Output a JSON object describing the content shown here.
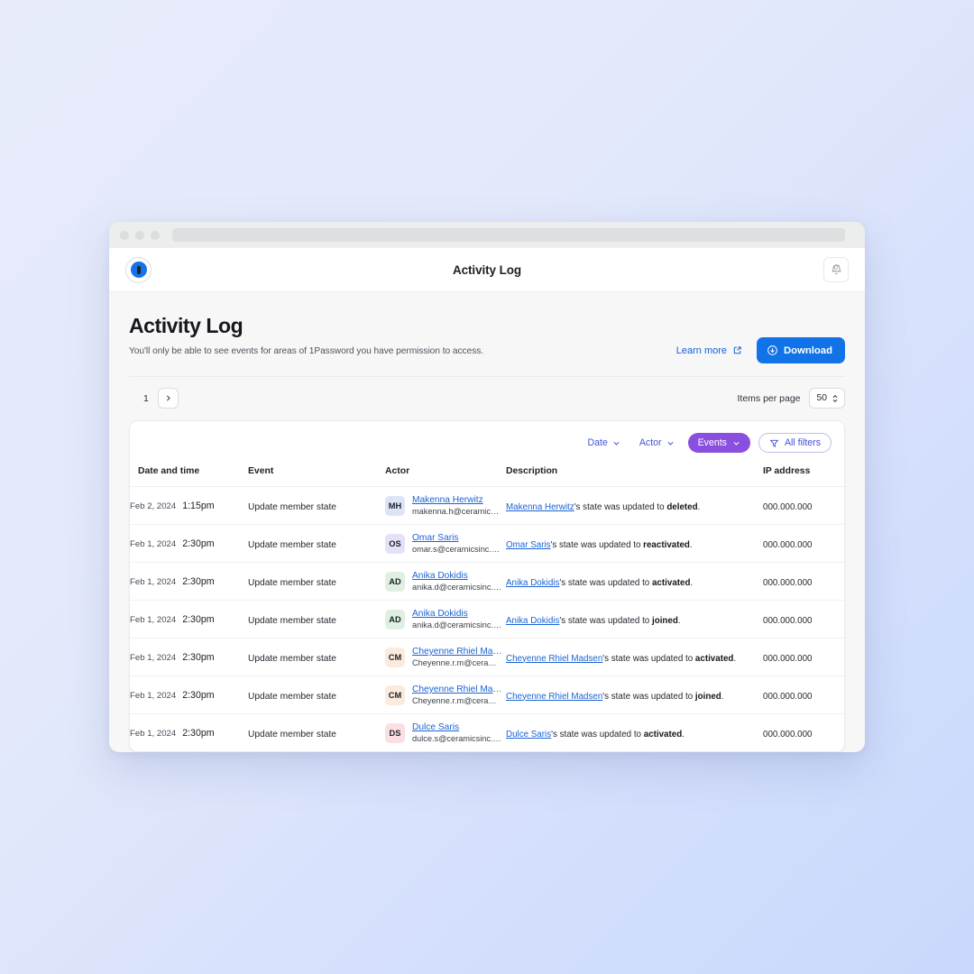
{
  "browser": {
    "traffic_lights": [
      "close",
      "minimize",
      "maximize"
    ],
    "address_bar_value": ""
  },
  "appbar": {
    "logo_icon": "1password-logo-icon",
    "title": "Activity Log",
    "notification_icon": "bell-icon",
    "notification_count": "0"
  },
  "page": {
    "title": "Activity Log",
    "subtitle": "You'll only be able to see events for areas of 1Password you have permission to access.",
    "learn_more_label": "Learn more",
    "learn_more_icon": "external-link-icon",
    "download_label": "Download",
    "download_icon": "download-circle-icon"
  },
  "pagination": {
    "current_page": "1",
    "next_icon": "chevron-right-icon",
    "items_per_page_label": "Items per page",
    "items_per_page_value": "50",
    "stepper_icon": "stepper-updown-icon"
  },
  "filters": {
    "date_label": "Date",
    "actor_label": "Actor",
    "events_label": "Events",
    "all_filters_label": "All filters",
    "chevron_icon": "chevron-down-icon",
    "funnel_icon": "funnel-icon",
    "events_active_color": "#8a4fe0",
    "link_color": "#4355d8"
  },
  "table": {
    "columns": [
      "Date and time",
      "Event",
      "Actor",
      "Description",
      "IP address"
    ],
    "rows": [
      {
        "date": "Feb 2, 2024",
        "time": "1:15pm",
        "event": "Update member state",
        "initials": "MH",
        "avatar_color": "#dbe5f5",
        "actor_name": "Makenna Herwitz",
        "actor_email": "makenna.h@ceramicsin...",
        "desc_link": "Makenna Herwitz",
        "desc_mid": "'s state was updated to ",
        "desc_bold": "deleted",
        "desc_end": ".",
        "ip": "000.000.000"
      },
      {
        "date": "Feb 1, 2024",
        "time": "2:30pm",
        "event": "Update member state",
        "initials": "OS",
        "avatar_color": "#e3e2f7",
        "actor_name": "Omar Saris",
        "actor_email": "omar.s@ceramicsinc.com",
        "desc_link": "Omar Saris",
        "desc_mid": "'s state was updated to ",
        "desc_bold": "reactivated",
        "desc_end": ".",
        "ip": "000.000.000"
      },
      {
        "date": "Feb 1, 2024",
        "time": "2:30pm",
        "event": "Update member state",
        "initials": "AD",
        "avatar_color": "#dff0e2",
        "actor_name": "Anika Dokidis",
        "actor_email": "anika.d@ceramicsinc.com",
        "desc_link": "Anika Dokidis",
        "desc_mid": "'s state was updated to ",
        "desc_bold": "activated",
        "desc_end": ".",
        "ip": "000.000.000"
      },
      {
        "date": "Feb 1, 2024",
        "time": "2:30pm",
        "event": "Update member state",
        "initials": "AD",
        "avatar_color": "#dff0e2",
        "actor_name": "Anika Dokidis",
        "actor_email": "anika.d@ceramicsinc.com",
        "desc_link": "Anika Dokidis",
        "desc_mid": "'s state was updated to ",
        "desc_bold": "joined",
        "desc_end": ".",
        "ip": "000.000.000"
      },
      {
        "date": "Feb 1, 2024",
        "time": "2:30pm",
        "event": "Update member state",
        "initials": "CM",
        "avatar_color": "#fbeade",
        "actor_name": "Cheyenne Rhiel Mad...",
        "actor_email": "Cheyenne.r.m@ceramic...",
        "desc_link": "Cheyenne Rhiel Madsen",
        "desc_mid": "'s state was updated to ",
        "desc_bold": "activated",
        "desc_end": ".",
        "ip": "000.000.000"
      },
      {
        "date": "Feb 1, 2024",
        "time": "2:30pm",
        "event": "Update member state",
        "initials": "CM",
        "avatar_color": "#fbeade",
        "actor_name": "Cheyenne Rhiel Mad...",
        "actor_email": "Cheyenne.r.m@ceramic...",
        "desc_link": "Cheyenne Rhiel Madsen",
        "desc_mid": "'s state was updated to ",
        "desc_bold": "joined",
        "desc_end": ".",
        "ip": "000.000.000"
      },
      {
        "date": "Feb 1, 2024",
        "time": "2:30pm",
        "event": "Update member state",
        "initials": "DS",
        "avatar_color": "#fbdfe3",
        "actor_name": "Dulce Saris",
        "actor_email": "dulce.s@ceramicsinc.com",
        "desc_link": "Dulce Saris",
        "desc_mid": "'s state was updated to ",
        "desc_bold": "activated",
        "desc_end": ".",
        "ip": "000.000.000"
      }
    ]
  }
}
